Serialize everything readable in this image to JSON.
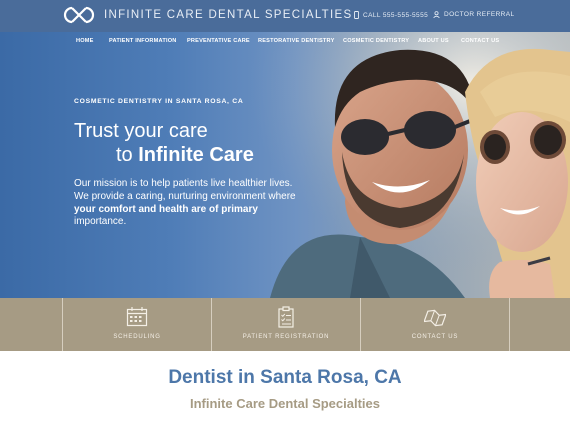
{
  "header": {
    "logo_text": "INFINITE CARE DENTAL SPECIALTIES",
    "phone": "CALL 555-555-5555",
    "referral": "DOCTOR REFERRAL"
  },
  "nav": {
    "items": [
      "HOME",
      "PATIENT INFORMATION",
      "PREVENTATIVE CARE",
      "RESTORATIVE DENTISTRY",
      "COSMETIC DENTISTRY",
      "ABOUT US",
      "CONTACT US"
    ]
  },
  "hero": {
    "subtitle": "COSMETIC DENTISTRY IN SANTA ROSA, CA",
    "title_line1": "Trust your care",
    "title_line2_prefix": "to ",
    "title_line2_bold": "Infinite Care",
    "body_plain1": "Our mission is to help patients live healthier lives. We provide a caring, nurturing environment where ",
    "body_bold": "your comfort and health are of primary",
    "body_plain2": " importance."
  },
  "services": [
    {
      "label": "SCHEDULING",
      "icon": "calendar-icon"
    },
    {
      "label": "PATIENT REGISTRATION",
      "icon": "clipboard-icon"
    },
    {
      "label": "CONTACT US",
      "icon": "map-icon"
    }
  ],
  "main": {
    "heading": "Dentist in Santa Rosa, CA",
    "subheading": "Infinite Care Dental Specialties"
  },
  "colors": {
    "header_blue": "#4a6c9a",
    "strip_tan": "#a69b84",
    "heading_blue": "#4d77a9"
  }
}
